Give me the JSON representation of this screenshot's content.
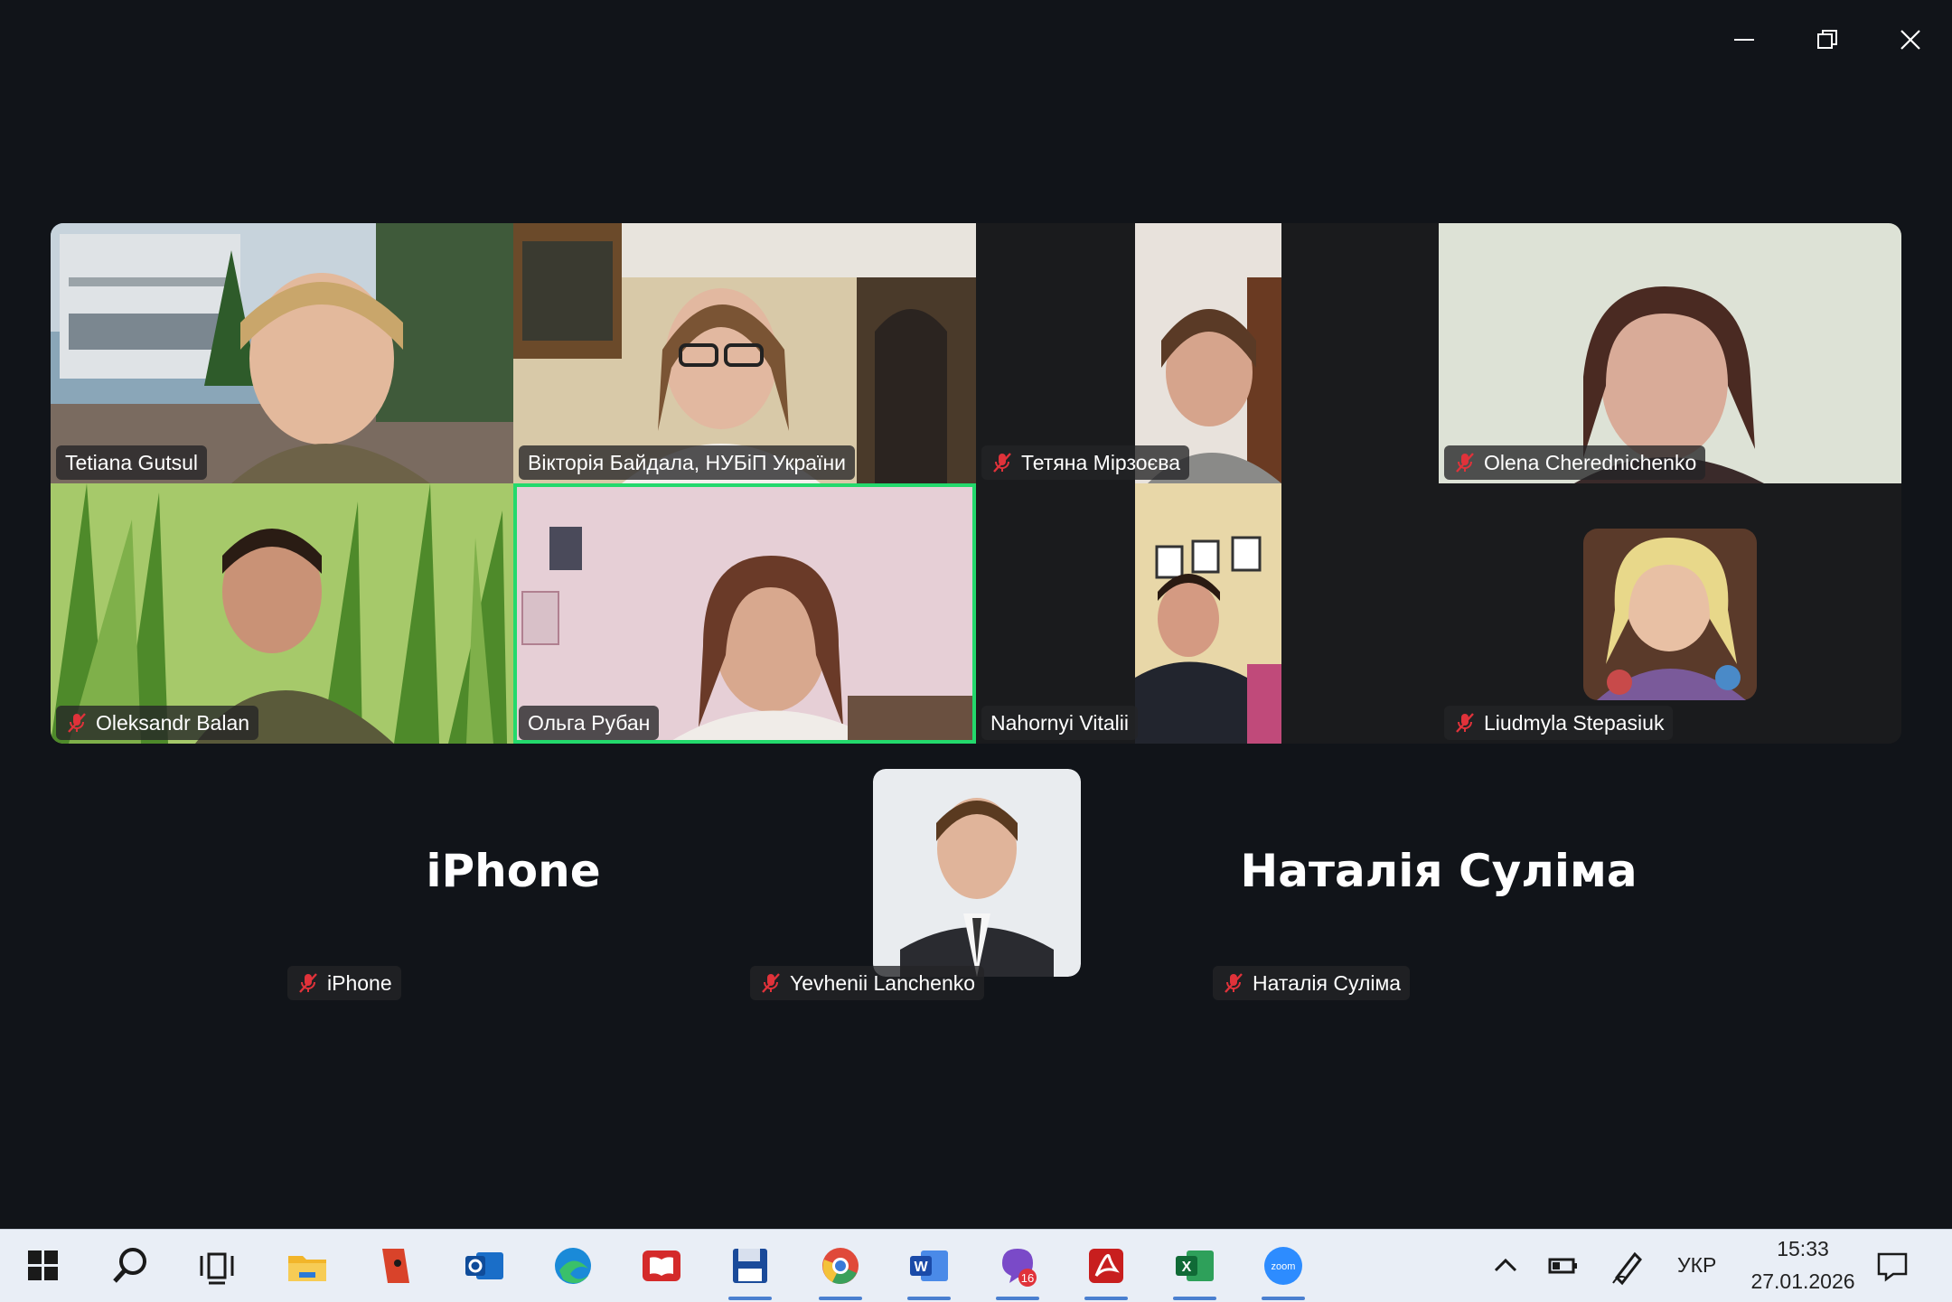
{
  "window": {
    "minimize_icon": "minimize-icon",
    "restore_icon": "restore-icon",
    "close_icon": "close-icon"
  },
  "participants": [
    {
      "name": "Tetiana Gutsul",
      "muted": false
    },
    {
      "name": "Вікторія Байдала, НУБіП України",
      "muted": false
    },
    {
      "name": "Тетяна Мірзоєва",
      "muted": true
    },
    {
      "name": "Olena Cherednichenko",
      "muted": true
    },
    {
      "name": "Oleksandr Balan",
      "muted": true
    },
    {
      "name": "Ольга Рубан",
      "muted": false,
      "speaking": true
    },
    {
      "name": "Nahornyi Vitalii",
      "muted": false
    },
    {
      "name": "Liudmyla Stepasiuk",
      "muted": true
    },
    {
      "name": "iPhone",
      "muted": true,
      "display": "iPhone"
    },
    {
      "name": "Yevhenii Lanchenko",
      "muted": true
    },
    {
      "name": "Наталія Суліма",
      "muted": true,
      "display": "Наталія Суліма"
    }
  ],
  "colors": {
    "background": "#111419",
    "speaking_border": "#23d96c",
    "muted_icon": "#e0323a",
    "taskbar": "#e9eef6"
  },
  "taskbar": {
    "apps": [
      "windows-start-icon",
      "search-icon",
      "task-view-icon",
      "file-explorer-icon",
      "app-red-icon",
      "outlook-icon",
      "edge-icon",
      "reader-icon",
      "save-icon",
      "chrome-icon",
      "word-icon",
      "viber-icon",
      "acrobat-icon",
      "excel-icon",
      "zoom-icon"
    ],
    "viber_badge": "16",
    "zoom_label": "zoom",
    "language": "УКР",
    "time": "15:33",
    "date": "27.01.2026"
  }
}
